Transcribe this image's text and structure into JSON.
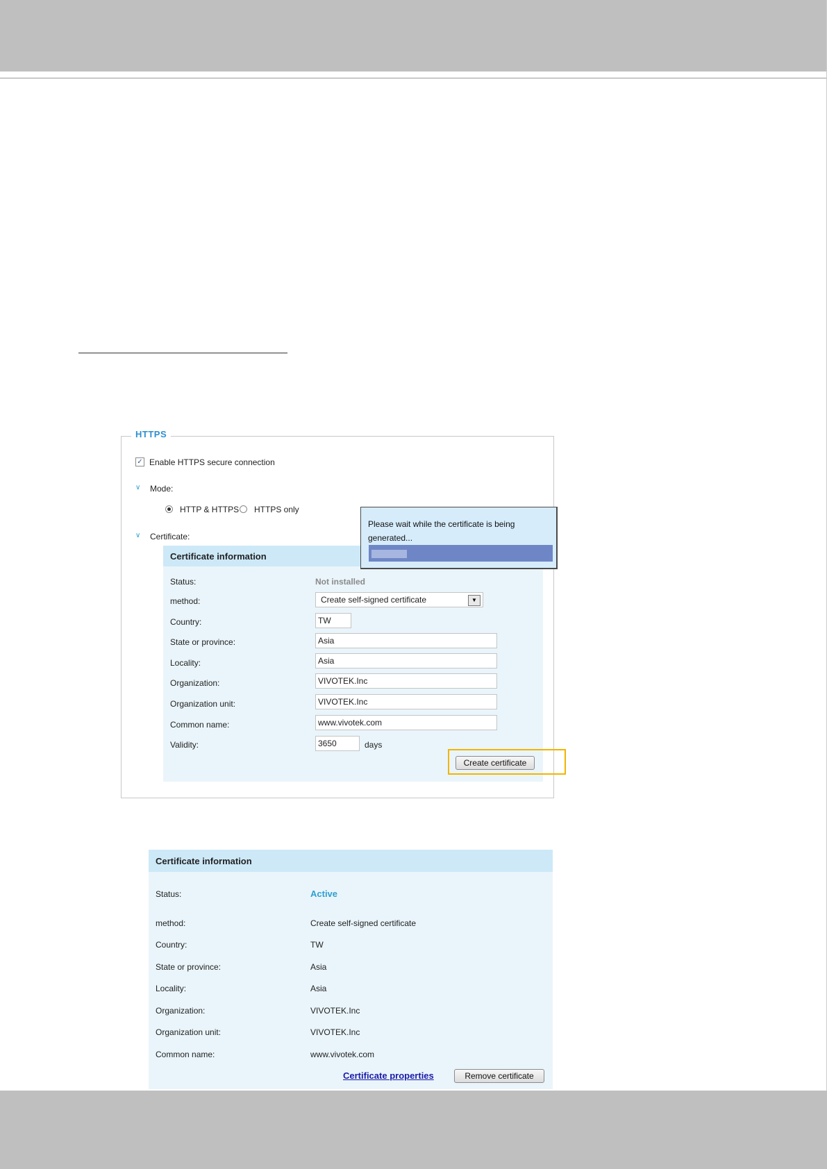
{
  "https_settings": {
    "legend": "HTTPS",
    "enable_label": "Enable HTTPS secure connection",
    "enable_checked": true,
    "mode_label": "Mode:",
    "mode_options": [
      "HTTP & HTTPS",
      "HTTPS only"
    ],
    "mode_selected": "HTTP & HTTPS",
    "certificate_label": "Certificate:",
    "cert_info": {
      "title": "Certificate information",
      "status_label": "Status:",
      "status_value": "Not installed",
      "method_label": "method:",
      "method_value": "Create self-signed certificate",
      "country_label": "Country:",
      "country_value": "TW",
      "state_label": "State or province:",
      "state_value": "Asia",
      "locality_label": "Locality:",
      "locality_value": "Asia",
      "organization_label": "Organization:",
      "organization_value": "VIVOTEK.Inc",
      "org_unit_label": "Organization unit:",
      "org_unit_value": "VIVOTEK.Inc",
      "common_name_label": "Common name:",
      "common_name_value": "www.vivotek.com",
      "validity_label": "Validity:",
      "validity_value": "3650",
      "validity_unit": "days",
      "create_button": "Create certificate"
    },
    "wait_popup": {
      "message": "Please wait while the certificate is being generated...",
      "progress": 0.2
    }
  },
  "cert_active": {
    "title": "Certificate information",
    "status_label": "Status:",
    "status_value": "Active",
    "method_label": "method:",
    "method_value": "Create self-signed certificate",
    "country_label": "Country:",
    "country_value": "TW",
    "state_label": "State or province:",
    "state_value": "Asia",
    "locality_label": "Locality:",
    "locality_value": "Asia",
    "organization_label": "Organization:",
    "organization_value": "VIVOTEK.Inc",
    "org_unit_label": "Organization unit:",
    "org_unit_value": "VIVOTEK.Inc",
    "common_name_label": "Common name:",
    "common_name_value": "www.vivotek.com",
    "properties_link": "Certificate properties",
    "remove_button": "Remove certificate"
  },
  "colors": {
    "accent": "#2e9fd0",
    "panel_bg": "#eaf5fb",
    "header_bg": "#cde9f8",
    "highlight": "#f2b400",
    "progress": "#6f86c6"
  }
}
